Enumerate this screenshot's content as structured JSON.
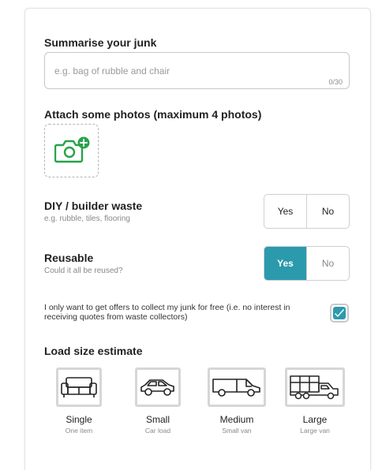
{
  "summary": {
    "label": "Summarise your junk",
    "placeholder": "e.g. bag of rubble and chair",
    "counter": "0/30"
  },
  "photos": {
    "label": "Attach some photos (maximum 4 photos)",
    "icon": "camera-plus-icon",
    "icon_color": "#27a34a"
  },
  "diy": {
    "label": "DIY / builder waste",
    "hint": "e.g. rubble, tiles, flooring",
    "yes": "Yes",
    "no": "No",
    "selected": "none"
  },
  "reusable": {
    "label": "Reusable",
    "hint": "Could it all be reused?",
    "yes": "Yes",
    "no": "No",
    "selected": "Yes"
  },
  "free_offer": {
    "text": "I only want to get offers to collect my junk for free (i.e. no interest in receiving quotes from waste collectors)",
    "checked": true
  },
  "load_size": {
    "label": "Load size estimate",
    "options": [
      {
        "name": "Single",
        "sub": "One item",
        "icon": "sofa-icon"
      },
      {
        "name": "Small",
        "sub": "Car load",
        "icon": "car-icon"
      },
      {
        "name": "Medium",
        "sub": "Small van",
        "icon": "van-icon"
      },
      {
        "name": "Large",
        "sub": "Large van",
        "icon": "truck-icon"
      }
    ]
  },
  "colors": {
    "accent": "#2b9aad",
    "camera_green": "#27a34a"
  }
}
